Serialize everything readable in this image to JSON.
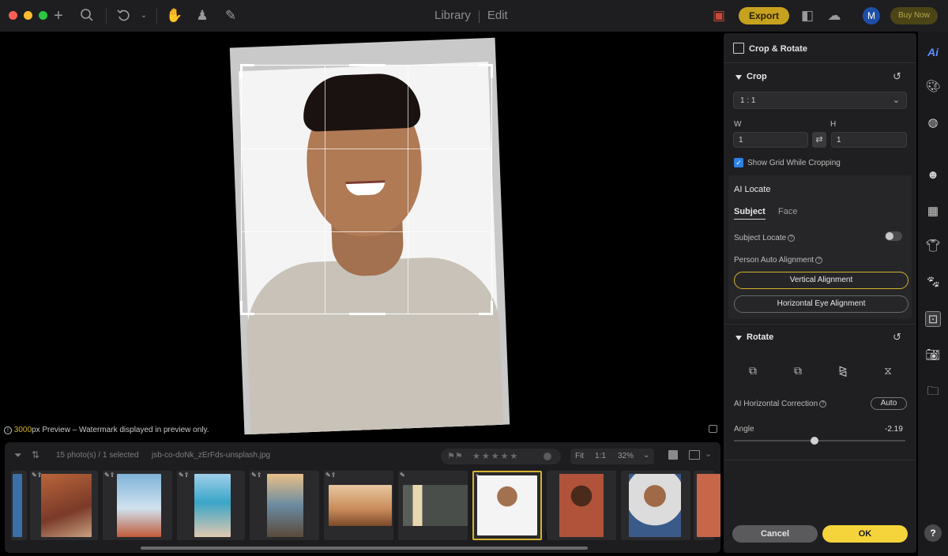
{
  "titlebar": {
    "tabs": [
      "Library",
      "Edit"
    ],
    "export_label": "Export",
    "buy_now_label": "Buy Now",
    "avatar_initial": "M"
  },
  "canvas": {
    "preview_px": "3000",
    "preview_suffix": "px Preview – Watermark displayed in preview only."
  },
  "filmstrip": {
    "count_text": "15 photo(s) / 1 selected",
    "filename": "jsb-co-doNk_zErFds-unsplash.jpg",
    "fit_label": "Fit",
    "one_to_one_label": "1:1",
    "zoom_value": "32%",
    "selected_index_badge": "11"
  },
  "panel": {
    "title": "Crop & Rotate",
    "crop": {
      "title": "Crop",
      "ratio_value": "1 : 1",
      "w_label": "W",
      "h_label": "H",
      "w_value": "1",
      "h_value": "1",
      "show_grid_label": "Show Grid While Cropping",
      "show_grid_checked": true
    },
    "ai_locate": {
      "title": "AI Locate",
      "tabs": [
        "Subject",
        "Face"
      ],
      "subject_locate_label": "Subject Locate",
      "person_auto_alignment_label": "Person Auto Alignment",
      "vertical_alignment_label": "Vertical Alignment",
      "horizontal_eye_alignment_label": "Horizontal Eye Alignment"
    },
    "rotate": {
      "title": "Rotate",
      "ai_horizontal_correction_label": "AI Horizontal Correction",
      "auto_label": "Auto",
      "angle_label": "Angle",
      "angle_value": "-2.19",
      "angle_slider_fraction": 0.47
    },
    "cancel_label": "Cancel",
    "ok_label": "OK"
  },
  "rail": {
    "ai_label": "Ai",
    "help_label": "?"
  },
  "colors": {
    "accent_gold": "#d6b230",
    "ok_yellow": "#f5d33a",
    "check_blue": "#2d82e6"
  }
}
